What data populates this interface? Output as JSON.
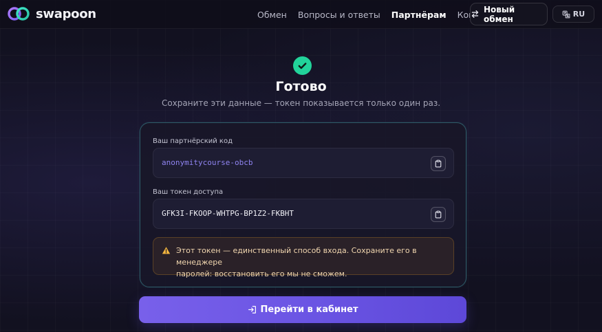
{
  "header": {
    "logo_text": "swapoon",
    "nav": [
      {
        "label": "Обмен",
        "active": false
      },
      {
        "label": "Вопросы и ответы",
        "active": false
      },
      {
        "label": "Партнёрам",
        "active": true
      },
      {
        "label": "Контакты",
        "active": false
      }
    ],
    "new_exchange_label": "Новый обмен",
    "lang_label": "RU"
  },
  "success": {
    "title": "Готово",
    "subtitle": "Сохраните эти данные — токен показывается только один раз."
  },
  "card": {
    "partner_code_label": "Ваш партнёрский код",
    "partner_code_value": "anonymitycourse-obcb",
    "token_label": "Ваш токен доступа",
    "token_value": "GFK3I-FKOOP-WHTPG-BP1Z2-FKBHT",
    "warning_line1": "Этот токен — единственный способ входа. Сохраните его в менеджере",
    "warning_line2": "паролей: восстановить его мы не сможем."
  },
  "cta_label": "Перейти в кабинет",
  "colors": {
    "accent": "#6b55e4",
    "success": "#22d39a",
    "code_text": "#8f83f0",
    "warning_text": "#f2d7b0",
    "warning_icon": "#f4b63f"
  },
  "icons": {
    "logo": "swapoon-logo-icon",
    "new_exchange": "swap-arrows-icon",
    "lang": "translate-icon",
    "check": "check-icon",
    "copy": "clipboard-icon",
    "warning": "warning-triangle-icon",
    "login": "login-icon"
  }
}
